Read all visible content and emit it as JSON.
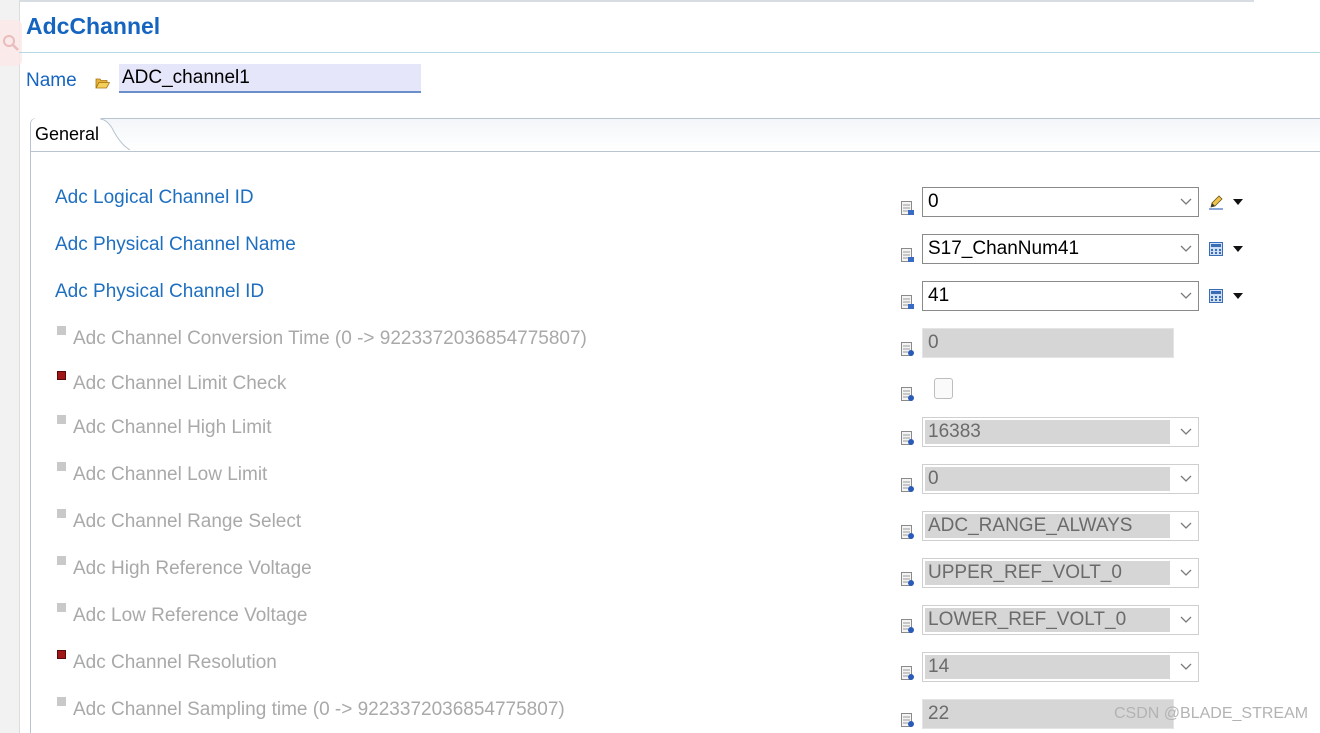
{
  "header": {
    "title": "AdcChannel"
  },
  "name_field": {
    "label": "Name",
    "value": "ADC_channel1"
  },
  "tabs": [
    {
      "label": "General"
    }
  ],
  "params": [
    {
      "label": "Adc Logical Channel ID",
      "value": "0",
      "enabled": true,
      "control": "combo"
    },
    {
      "label": "Adc Physical Channel Name",
      "value": "S17_ChanNum41",
      "enabled": true,
      "control": "combo"
    },
    {
      "label": "Adc Physical Channel ID",
      "value": "41",
      "enabled": true,
      "control": "combo"
    },
    {
      "label": "Adc Channel Conversion Time (0 -> 9223372036854775807)",
      "value": "0",
      "enabled": false,
      "control": "text"
    },
    {
      "label": "Adc Channel Limit Check",
      "value": "",
      "enabled": false,
      "control": "checkbox",
      "checked": false
    },
    {
      "label": "Adc Channel High Limit",
      "value": "16383",
      "enabled": false,
      "control": "combo"
    },
    {
      "label": "Adc Channel Low Limit",
      "value": "0",
      "enabled": false,
      "control": "combo"
    },
    {
      "label": "Adc Channel Range Select",
      "value": "ADC_RANGE_ALWAYS",
      "enabled": false,
      "control": "combo"
    },
    {
      "label": "Adc High Reference Voltage",
      "value": "UPPER_REF_VOLT_0",
      "enabled": false,
      "control": "combo"
    },
    {
      "label": "Adc Low Reference Voltage",
      "value": "LOWER_REF_VOLT_0",
      "enabled": false,
      "control": "combo"
    },
    {
      "label": "Adc Channel Resolution",
      "value": "14",
      "enabled": false,
      "control": "combo"
    },
    {
      "label": "Adc Channel Sampling time (0 -> 9223372036854775807)",
      "value": "22",
      "enabled": false,
      "control": "text"
    }
  ],
  "watermark": "CSDN @BLADE_STREAM",
  "colors": {
    "accent": "#1565c0",
    "label_enabled": "#1e6fc0",
    "label_disabled": "#a9a9a9",
    "required_marker": "#a01515"
  },
  "icons": {
    "name": "folder-open-icon",
    "param": "parameter-value-icon",
    "row1_tool": "edit-pen-icon",
    "row2_tool": "calculator-icon",
    "row3_tool": "calculator-icon",
    "dropdown": "chevron-down-icon",
    "menu": "triangle-down-icon"
  }
}
